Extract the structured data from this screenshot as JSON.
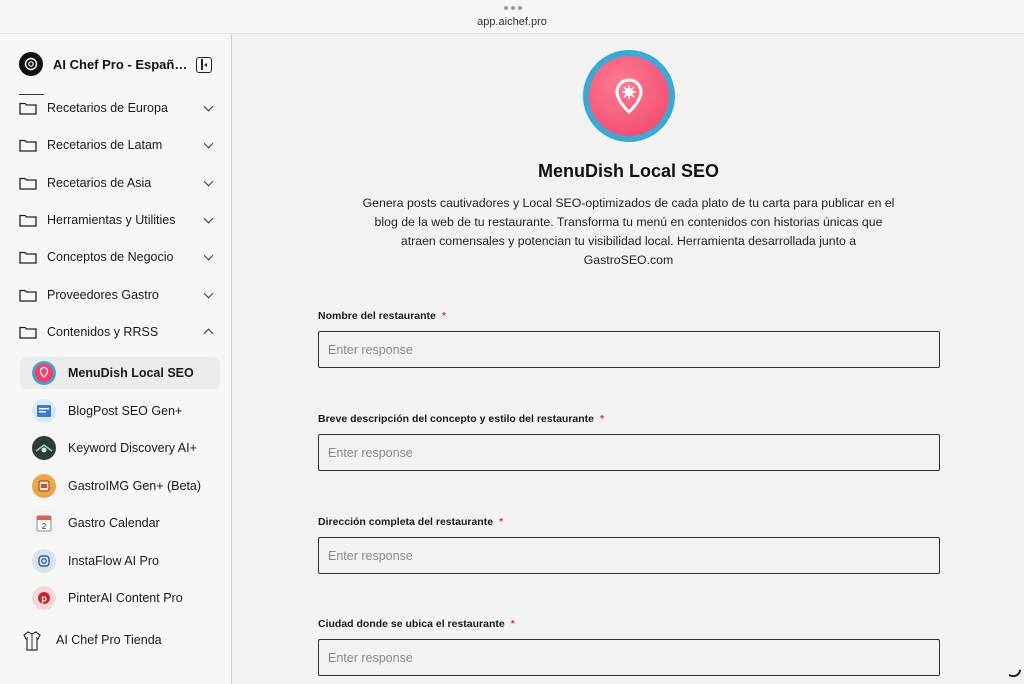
{
  "browser": {
    "url": "app.aichef.pro"
  },
  "brand": {
    "name": "AI Chef Pro - Españ…",
    "icon": "openai-logo-icon"
  },
  "sidebar": {
    "folders": [
      {
        "label": "Recetarios de Europa",
        "expanded": false
      },
      {
        "label": "Recetarios de Latam",
        "expanded": false
      },
      {
        "label": "Recetarios de Asia",
        "expanded": false
      },
      {
        "label": "Herramientas y Utilities",
        "expanded": false
      },
      {
        "label": "Conceptos de Negocio",
        "expanded": false
      },
      {
        "label": "Proveedores Gastro",
        "expanded": false
      },
      {
        "label": "Contenidos y RRSS",
        "expanded": true
      }
    ],
    "apps": [
      {
        "label": "MenuDish Local SEO",
        "active": true,
        "icon": "map-pin-icon"
      },
      {
        "label": "BlogPost SEO Gen+",
        "active": false,
        "icon": "blog-icon"
      },
      {
        "label": "Keyword Discovery AI+",
        "active": false,
        "icon": "keyword-icon"
      },
      {
        "label": "GastroIMG Gen+ (Beta)",
        "active": false,
        "icon": "image-gen-icon"
      },
      {
        "label": "Gastro Calendar",
        "active": false,
        "icon": "calendar-icon"
      },
      {
        "label": "InstaFlow AI Pro",
        "active": false,
        "icon": "instagram-icon"
      },
      {
        "label": "PinterAI Content Pro",
        "active": false,
        "icon": "pinterest-icon"
      }
    ],
    "store": {
      "label": "AI Chef Pro Tienda",
      "icon": "chef-jacket-icon"
    }
  },
  "main": {
    "title": "MenuDish Local SEO",
    "description": "Genera posts cautivadores y Local SEO-optimizados de cada plato de tu carta para publicar en el blog de la web de tu restaurante. Transforma tu menú en contenidos con historias únicas que atraen comensales y potencian tu visibilidad local. Herramienta desarrollada junto a GastroSEO.com",
    "fields": [
      {
        "label": "Nombre del restaurante",
        "required_mark": "*",
        "placeholder": "Enter response",
        "value": ""
      },
      {
        "label": "Breve descripción del concepto y estilo del restaurante",
        "required_mark": "*",
        "placeholder": "Enter response",
        "value": ""
      },
      {
        "label": "Dirección completa del restaurante",
        "required_mark": "*",
        "placeholder": "Enter response",
        "value": ""
      },
      {
        "label": "Ciudad donde se ubica el restaurante",
        "required_mark": "*",
        "placeholder": "Enter response",
        "value": ""
      }
    ]
  },
  "colors": {
    "accent_pink": "#f0436a",
    "accent_blue": "#3aa9d6",
    "required": "#d93a3a"
  }
}
